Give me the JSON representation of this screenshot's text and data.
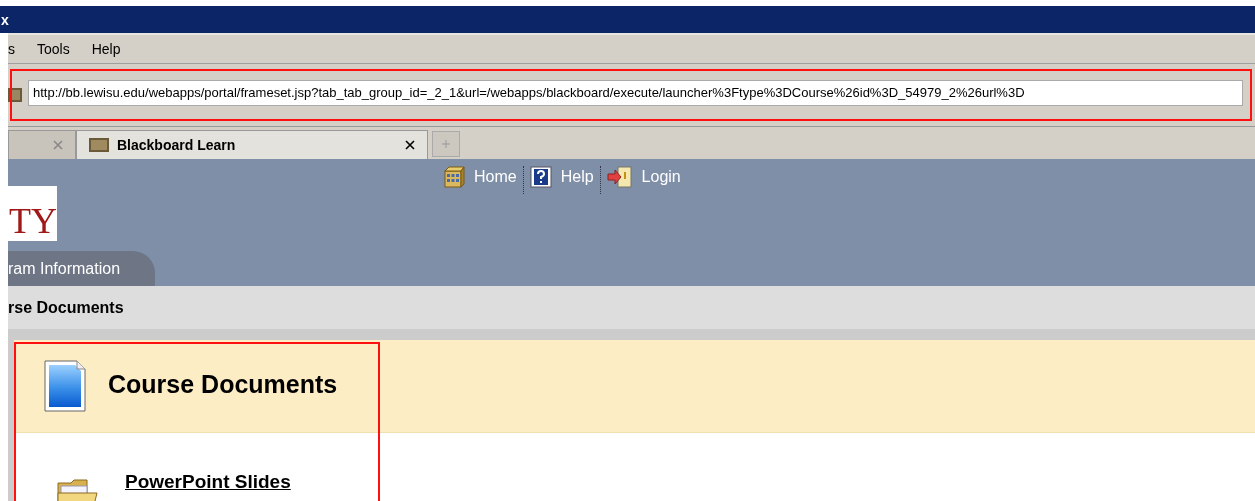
{
  "window": {
    "title": "x"
  },
  "menu": [
    {
      "label": "s"
    },
    {
      "label": "Tools"
    },
    {
      "label": "Help"
    }
  ],
  "address_bar": {
    "value": "http://bb.lewisu.edu/webapps/portal/frameset.jsp?tab_tab_group_id=_2_1&url=/webapps/blackboard/execute/launcher%3Ftype%3DCourse%26id%3D_54979_2%26url%3D",
    "highlighted": true
  },
  "tabs": [
    {
      "selected": false
    },
    {
      "label": "Blackboard Learn",
      "selected": true
    }
  ],
  "header_links": [
    {
      "kind": "home",
      "label": "Home"
    },
    {
      "kind": "help",
      "label": "Help"
    },
    {
      "kind": "login",
      "label": "Login"
    }
  ],
  "logo": {
    "text": "TY"
  },
  "nav_tabs": [
    {
      "label": "ram Information",
      "selected": false
    }
  ],
  "breadcrumb": "rse Documents",
  "content": {
    "title": "Course Documents",
    "highlighted": true,
    "items": [
      {
        "label": "PowerPoint Slides"
      }
    ]
  }
}
